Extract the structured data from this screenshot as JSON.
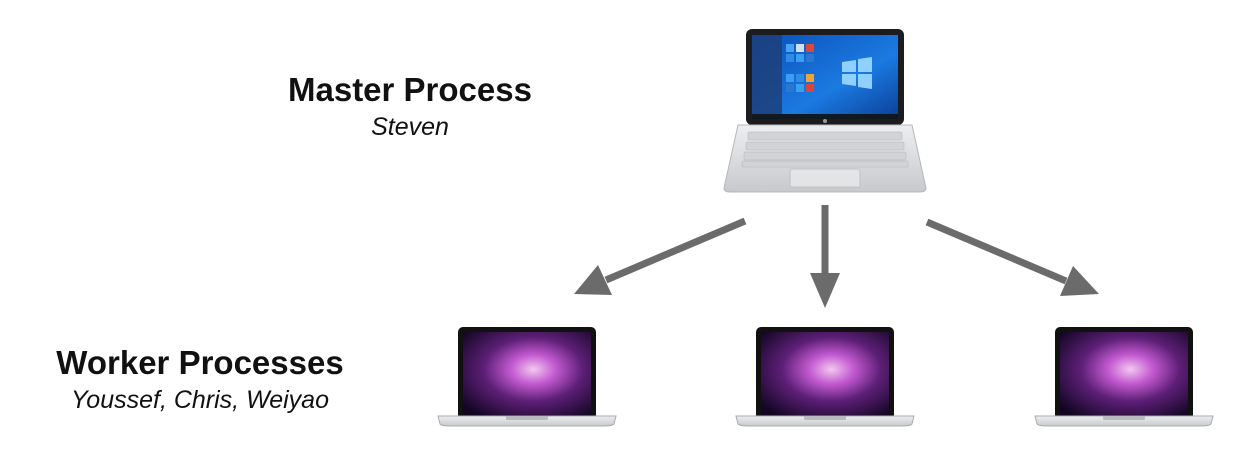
{
  "master": {
    "title": "Master Process",
    "subtitle": "Steven"
  },
  "workers": {
    "title": "Worker Processes",
    "subtitle": "Youssef,  Chris, Weiyao"
  },
  "colors": {
    "arrow": "#6b6b6b",
    "laptop_silver": "#d8d9db",
    "windows_blue": "#1e74d6",
    "mac_wallpaper": "#7a2f93"
  },
  "icons": {
    "master_device": "windows-laptop-icon",
    "worker_device": "macbook-icon"
  }
}
